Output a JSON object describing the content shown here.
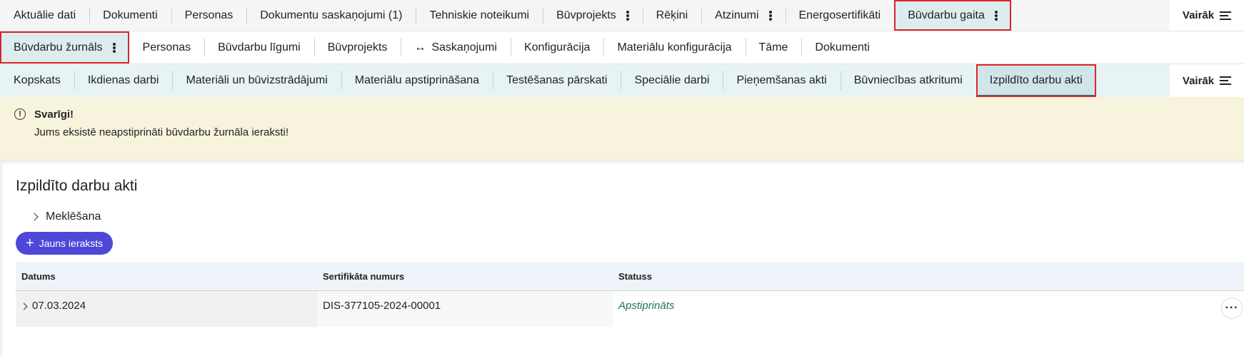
{
  "nav1": {
    "tabs": [
      {
        "label": "Aktuālie dati"
      },
      {
        "label": "Dokumenti"
      },
      {
        "label": "Personas"
      },
      {
        "label": "Dokumentu saskaņojumi (1)"
      },
      {
        "label": "Tehniskie noteikumi"
      },
      {
        "label": "Būvprojekts"
      },
      {
        "label": "Rēķini"
      },
      {
        "label": "Atzinumi"
      },
      {
        "label": "Energosertifikāti"
      },
      {
        "label": "Būvdarbu gaita"
      }
    ],
    "more_label": "Vairāk"
  },
  "nav2": {
    "tabs": [
      {
        "label": "Būvdarbu žurnāls"
      },
      {
        "label": "Personas"
      },
      {
        "label": "Būvdarbu līgumi"
      },
      {
        "label": "Būvprojekts"
      },
      {
        "label": "Saskaņojumi"
      },
      {
        "label": "Konfigurācija"
      },
      {
        "label": "Materiālu konfigurācija"
      },
      {
        "label": "Tāme"
      },
      {
        "label": "Dokumenti"
      }
    ]
  },
  "nav3": {
    "tabs": [
      {
        "label": "Kopskats"
      },
      {
        "label": "Ikdienas darbi"
      },
      {
        "label": "Materiāli un būvizstrādājumi"
      },
      {
        "label": "Materiālu apstiprināšana"
      },
      {
        "label": "Testēšanas pārskati"
      },
      {
        "label": "Speciālie darbi"
      },
      {
        "label": "Pieņemšanas akti"
      },
      {
        "label": "Būvniecības atkritumi"
      },
      {
        "label": "Izpildīto darbu akti"
      }
    ],
    "more_label": "Vairāk"
  },
  "alert": {
    "title": "Svarīgi!",
    "message": "Jums eksistē neapstiprināti būvdarbu žurnāla ieraksti!"
  },
  "page": {
    "title": "Izpildīto darbu akti",
    "search_label": "Meklēšana",
    "new_button": "Jauns ieraksts"
  },
  "table": {
    "headers": [
      "Datums",
      "Sertifikāta numurs",
      "Statuss"
    ],
    "rows": [
      {
        "date": "07.03.2024",
        "cert": "DIS-377105-2024-00001",
        "status": "Apstiprināts"
      }
    ]
  }
}
